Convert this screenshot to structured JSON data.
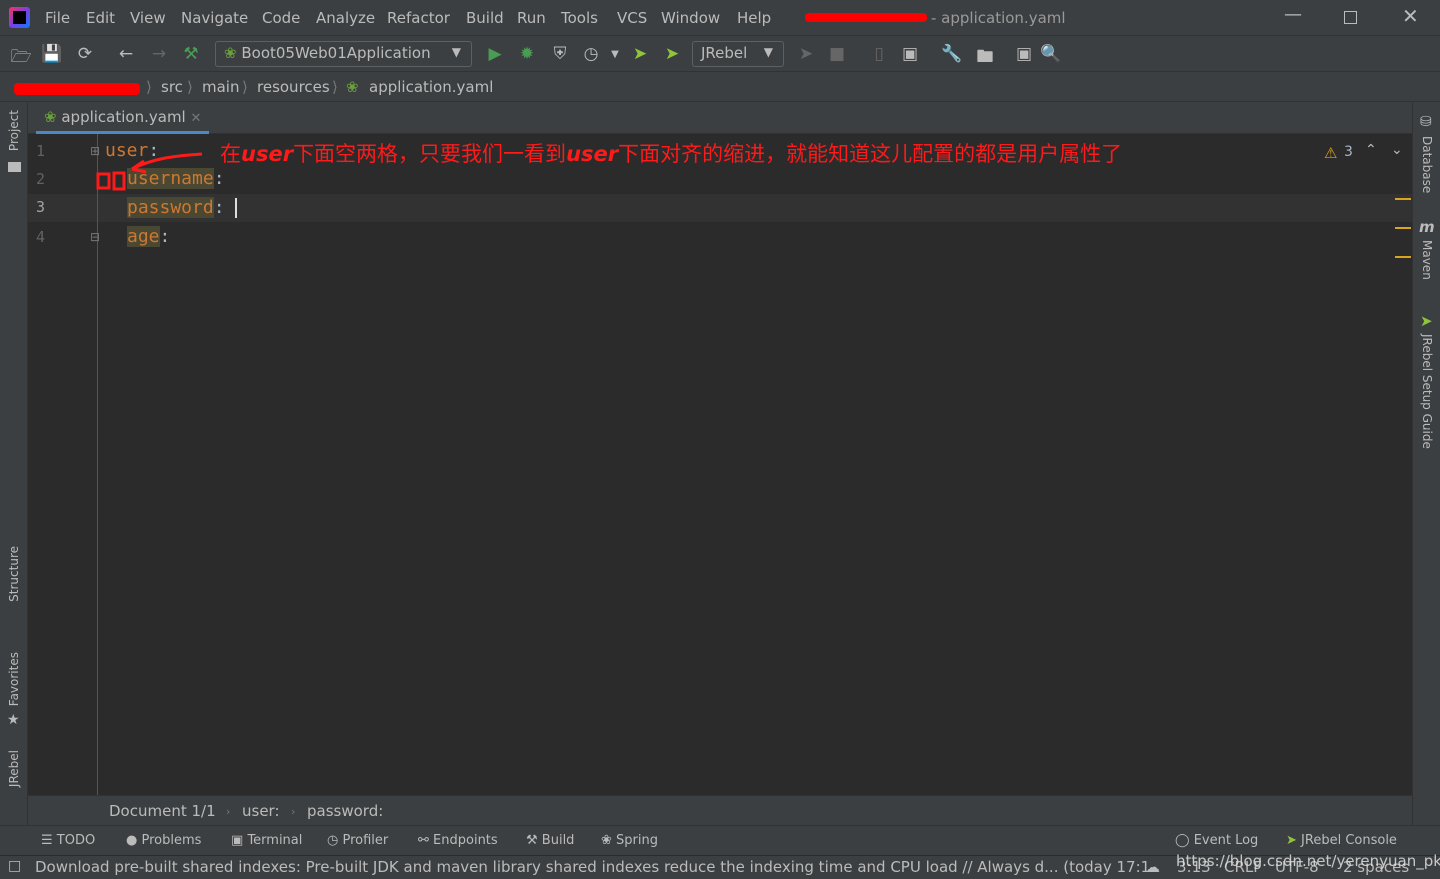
{
  "window": {
    "title_suffix": "- application.yaml",
    "controls": [
      "minimize",
      "maximize",
      "close"
    ]
  },
  "menu": [
    "File",
    "Edit",
    "View",
    "Navigate",
    "Code",
    "Analyze",
    "Refactor",
    "Build",
    "Run",
    "Tools",
    "VCS",
    "Window",
    "Help"
  ],
  "toolbar": {
    "run_config": "Boot05Web01Application",
    "jrebel": "JRebel"
  },
  "breadcrumb": [
    "src",
    "main",
    "resources",
    "application.yaml"
  ],
  "tab": {
    "label": "application.yaml"
  },
  "editor": {
    "lines": [
      {
        "n": "1",
        "key": "user",
        "rest": ":"
      },
      {
        "n": "2",
        "key": "username",
        "rest": ":"
      },
      {
        "n": "3",
        "key": "password",
        "rest": ": "
      },
      {
        "n": "4",
        "key": "age",
        "rest": ":"
      }
    ],
    "warnings": "3",
    "annotation": {
      "p1": "在",
      "u1": "user",
      "p2": "下面空两格，只要我们一看到",
      "u2": "user",
      "p3": "下面对齐的缩进，就能知道这儿配置的都是用户属性了"
    },
    "annotation_color": "#ff0000"
  },
  "bottom_breadcrumb": [
    "Document 1/1",
    "user:",
    "password:"
  ],
  "left_tools": [
    "Project",
    "Structure",
    "Favorites",
    "JRebel"
  ],
  "right_tools": [
    "Database",
    "Maven",
    "JRebel Setup Guide"
  ],
  "tool_windows": [
    "TODO",
    "Problems",
    "Terminal",
    "Profiler",
    "Endpoints",
    "Build",
    "Spring"
  ],
  "tool_windows_right": [
    "Event Log",
    "JRebel Console"
  ],
  "status": {
    "message": "Download pre-built shared indexes: Pre-built JDK and maven library shared indexes reduce the indexing time and CPU load // Always d... (today 17:1",
    "position": "3:13",
    "line_sep": "CRLF",
    "encoding": "UTF-8",
    "indent": "2 spaces",
    "watermark": "https://blog.csdn.net/yerenyuan_pku"
  }
}
